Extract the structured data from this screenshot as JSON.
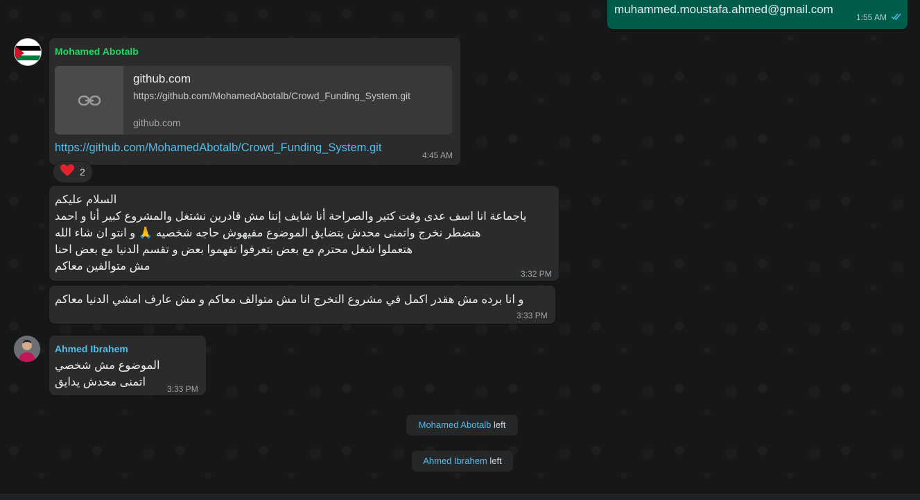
{
  "outgoing_top": {
    "text": "muhammed.moustafa.ahmed@gmail.com",
    "time": "1:55 AM",
    "status_icon": "double-check-icon"
  },
  "message_link": {
    "sender": "Mohamed Abotalb",
    "sender_color": "#25d366",
    "avatar_icon": "palestine-flag-avatar",
    "preview_title": "github.com",
    "preview_url": "https://github.com/MohamedAbotalb/Crowd_Funding_System.git",
    "preview_domain": "github.com",
    "link_text": "https://github.com/MohamedAbotalb/Crowd_Funding_System.git",
    "time": "4:45 AM",
    "reaction_icon": "red-heart-icon",
    "reaction_count": "2"
  },
  "message_long": {
    "lines": [
      "السلام عليكم",
      "ياجماعة انا اسف عدى وقت كتير والصراحة أنا شايف إننا مش قادرين نشتغل والمشروع كبير أنا و احمد",
      "هنضطر نخرج واتمنى محدش يتضايق الموضوع مفيهوش حاجه شخصيه 🙏 و انتو ان شاء الله",
      "هتعملوا شغل محترم مع بعض بتعرفوا تفهموا بعض و تقسم الدنيا مع بعض احنا",
      "مش متوالفين معاكم"
    ],
    "time": "3:32 PM"
  },
  "message_short": {
    "text": "و انا برده مش هقدر اكمل في مشروع التخرج انا مش متوالف معاكم و مش عارف امشي الدنيا معاكم",
    "time": "3:33 PM"
  },
  "message_ahmed": {
    "sender": "Ahmed Ibrahem",
    "sender_color": "#53bdeb",
    "avatar_icon": "person-photo-avatar",
    "lines": [
      "الموضوع مش شخصي",
      "اتمنى محدش يدايق"
    ],
    "time": "3:33 PM"
  },
  "system_messages": [
    {
      "name": "Mohamed Abotalb",
      "action": "left"
    },
    {
      "name": "Ahmed Ibrahem",
      "action": "left"
    }
  ]
}
